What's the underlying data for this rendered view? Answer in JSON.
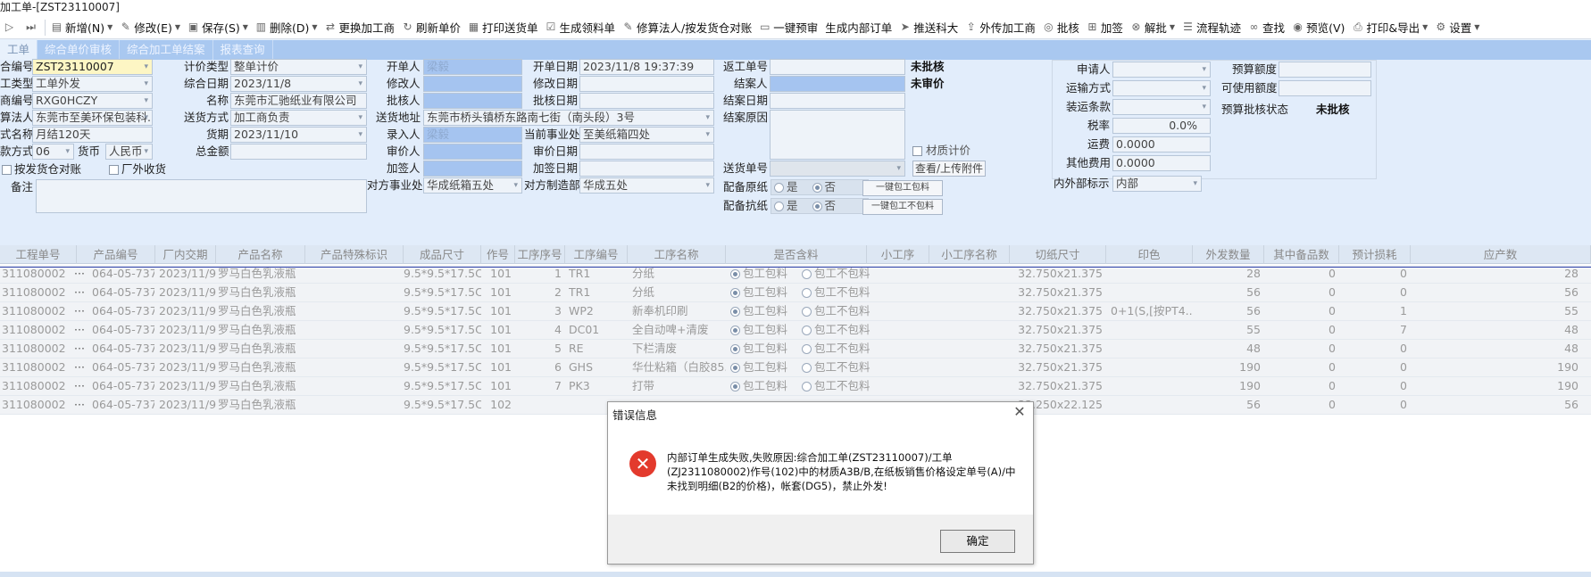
{
  "window": {
    "title": "加工单-[ZST23110007]"
  },
  "toolbar": {
    "items": [
      {
        "label": "新增(N)",
        "icon": "new-doc-icon",
        "dd": true
      },
      {
        "label": "修改(E)",
        "icon": "edit-icon",
        "dd": true
      },
      {
        "label": "保存(S)",
        "icon": "save-icon",
        "dd": true
      },
      {
        "label": "删除(D)",
        "icon": "delete-icon",
        "dd": true
      },
      {
        "label": "更换加工商",
        "icon": "swap-icon"
      },
      {
        "label": "刷新单价",
        "icon": "refresh-price-icon"
      },
      {
        "label": "打印送货单",
        "icon": "print-icon"
      },
      {
        "label": "生成领料单",
        "icon": "check-doc-icon"
      },
      {
        "label": "修算法人/按发货仓对账",
        "icon": "calc-icon"
      },
      {
        "label": "一键预审",
        "icon": "doc-icon"
      },
      {
        "label": "生成内部订单",
        "icon": ""
      },
      {
        "label": "推送科大",
        "icon": "push-icon"
      },
      {
        "label": "外传加工商",
        "icon": "export-icon"
      },
      {
        "label": "批核",
        "icon": "approve-icon"
      },
      {
        "label": "加签",
        "icon": "sign-icon"
      },
      {
        "label": "解批",
        "icon": "cancel-icon",
        "dd": true
      },
      {
        "label": "流程轨迹",
        "icon": "flow-icon"
      },
      {
        "label": "查找",
        "icon": "binoculars-icon"
      },
      {
        "label": "预览(V)",
        "icon": "preview-icon"
      },
      {
        "label": "打印&导出",
        "icon": "printer-icon",
        "dd": true
      },
      {
        "label": "设置",
        "icon": "gear-icon",
        "dd": true
      }
    ]
  },
  "tabs": [
    "工单",
    "综合单价审核",
    "综合加工单结案",
    "报表查询"
  ],
  "form": {
    "order_no_label": "合编号",
    "order_no": "ZST23110007",
    "order_type_label": "工类型",
    "order_type": "工单外发",
    "vendor_code_label": "商编号",
    "vendor_code": "RXG0HCZY",
    "calc_person_label": "算法人",
    "calc_person": "东莞市至美环保包装科...",
    "pay_name_label": "式名称",
    "pay_name": "月结120天",
    "pay_method_label": "款方式",
    "pay_method": "06",
    "currency_label": "货币",
    "currency": "人民币",
    "by_warehouse_label": "按发货仓对账",
    "outside_recv_label": "厂外收货",
    "remark_label": "备注",
    "price_type_label": "计价类型",
    "price_type": "整单计价",
    "date_label": "综合日期",
    "date": "2023/11/8",
    "name_label": "名称",
    "name": "东莞市汇驰纸业有限公司",
    "ship_method_label": "送货方式",
    "ship_method": "加工商负责",
    "due_label": "货期",
    "due": "2023/11/10",
    "total_label": "总金额",
    "total": "",
    "opener_label": "开单人",
    "opener": "梁毅",
    "modifier_label": "修改人",
    "checker_label": "批核人",
    "ship_addr_label": "送货地址",
    "ship_addr": "东莞市桥头镇桥东路南七街（南头段）3号",
    "entry_label": "录入人",
    "entry": "梁毅",
    "auditor_label": "审价人",
    "signer_label": "加签人",
    "counter_dept_label": "对方事业处",
    "counter_dept": "华成纸箱五处",
    "open_date_label": "开单日期",
    "open_date": "2023/11/8 19:37:39",
    "mod_date_label": "修改日期",
    "check_date_label": "批核日期",
    "cur_dept_label": "当前事业处",
    "cur_dept": "至美纸箱四处",
    "audit_date_label": "审价日期",
    "sign_date_label": "加签日期",
    "counter_mfg_label": "对方制造部",
    "counter_mfg": "华成五处",
    "return_no_label": "返工单号",
    "return_status": "未批核",
    "closer_label": "结案人",
    "price_status": "未审价",
    "close_date_label": "结案日期",
    "close_reason_label": "结案原因",
    "material_price_label": "材质计价",
    "ship_no_label": "送货单号",
    "attach_btn": "查看/上传附件",
    "paper_label": "配备原纸",
    "board_label": "配备抗纸",
    "yes": "是",
    "no": "否",
    "btn_include": "一键包工包料",
    "btn_exclude": "一键包工不包料",
    "applicant_label": "申请人",
    "transport_label": "运输方式",
    "loading_label": "装运条款",
    "tax_label": "税率",
    "tax": "0.0%",
    "freight_label": "运费",
    "freight": "0.0000",
    "other_label": "其他费用",
    "other": "0.0000",
    "inout_label": "内外部标示",
    "inout": "内部",
    "budget_label": "预算额度",
    "avail_label": "可使用额度",
    "budget_status_label": "预算批核状态",
    "budget_status": "未批核"
  },
  "grid": {
    "headers": [
      "工程单号",
      "产品编号",
      "厂内交期",
      "产品名称",
      "产品特殊标识",
      "成品尺寸",
      "作号",
      "工序序号",
      "工序编号",
      "工序名称",
      "是否含料",
      "小工序",
      "小工序名称",
      "切纸尺寸",
      "印色",
      "外发数量",
      "其中备品数",
      "预计损耗",
      "应产数"
    ],
    "incl_label": "包工包料",
    "excl_label": "包工不包料",
    "rows": [
      {
        "job": "311080002",
        "prod": "064-05-7378-...",
        "date": "2023/11/9",
        "pname": "罗马白色乳液瓶",
        "size": "9.5*9.5*17.5CM",
        "zh": "101",
        "seq": "1",
        "pcode": "TR1",
        "pname2": "分纸",
        "cut": "32.750x21.375",
        "color": "",
        "qty": "28",
        "spare": "0",
        "loss": "0",
        "out": "28"
      },
      {
        "job": "311080002",
        "prod": "064-05-7378-...",
        "date": "2023/11/9",
        "pname": "罗马白色乳液瓶",
        "size": "9.5*9.5*17.5CM",
        "zh": "101",
        "seq": "2",
        "pcode": "TR1",
        "pname2": "分纸",
        "cut": "32.750x21.375",
        "color": "",
        "qty": "56",
        "spare": "0",
        "loss": "0",
        "out": "56"
      },
      {
        "job": "311080002",
        "prod": "064-05-7378-...",
        "date": "2023/11/9",
        "pname": "罗马白色乳液瓶",
        "size": "9.5*9.5*17.5CM",
        "zh": "101",
        "seq": "3",
        "pcode": "WP2",
        "pname2": "新奉机印刷",
        "cut": "32.750x21.375",
        "color": "0+1(S,[按PT4...",
        "qty": "56",
        "spare": "0",
        "loss": "1",
        "out": "55"
      },
      {
        "job": "311080002",
        "prod": "064-05-7378-...",
        "date": "2023/11/9",
        "pname": "罗马白色乳液瓶",
        "size": "9.5*9.5*17.5CM",
        "zh": "101",
        "seq": "4",
        "pcode": "DC01",
        "pname2": "全自动啤+清废",
        "cut": "32.750x21.375",
        "color": "",
        "qty": "55",
        "spare": "0",
        "loss": "7",
        "out": "48"
      },
      {
        "job": "311080002",
        "prod": "064-05-7378-...",
        "date": "2023/11/9",
        "pname": "罗马白色乳液瓶",
        "size": "9.5*9.5*17.5CM",
        "zh": "101",
        "seq": "5",
        "pcode": "RE",
        "pname2": "下栏清废",
        "cut": "32.750x21.375",
        "color": "",
        "qty": "48",
        "spare": "0",
        "loss": "0",
        "out": "48"
      },
      {
        "job": "311080002",
        "prod": "064-05-7378-...",
        "date": "2023/11/9",
        "pname": "罗马白色乳液瓶",
        "size": "9.5*9.5*17.5CM",
        "zh": "101",
        "seq": "6",
        "pcode": "GHS",
        "pname2": "华仕粘箱（白胶85...",
        "cut": "32.750x21.375",
        "color": "",
        "qty": "190",
        "spare": "0",
        "loss": "0",
        "out": "190"
      },
      {
        "job": "311080002",
        "prod": "064-05-7378-...",
        "date": "2023/11/9",
        "pname": "罗马白色乳液瓶",
        "size": "9.5*9.5*17.5CM",
        "zh": "101",
        "seq": "7",
        "pcode": "PK3",
        "pname2": "打带",
        "cut": "32.750x21.375",
        "color": "",
        "qty": "190",
        "spare": "0",
        "loss": "0",
        "out": "190"
      },
      {
        "job": "311080002",
        "prod": "064-05-7378-...",
        "date": "2023/11/9",
        "pname": "罗马白色乳液瓶",
        "size": "9.5*9.5*17.5CM",
        "zh": "102",
        "seq": "",
        "pcode": "",
        "pname2": "",
        "cut": "33.250x22.125",
        "color": "",
        "qty": "56",
        "spare": "0",
        "loss": "0",
        "out": "56"
      }
    ]
  },
  "dialog": {
    "title": "错误信息",
    "message": "内部订单生成失败,失败原因:综合加工单(ZST23110007)/工单(ZJ2311080002)作号(102)中的材质A3B/B,在纸板销售价格设定单号(A)/中未找到明细(B2的价格)，帐套(DG5)，禁止外发!",
    "ok": "确定"
  }
}
